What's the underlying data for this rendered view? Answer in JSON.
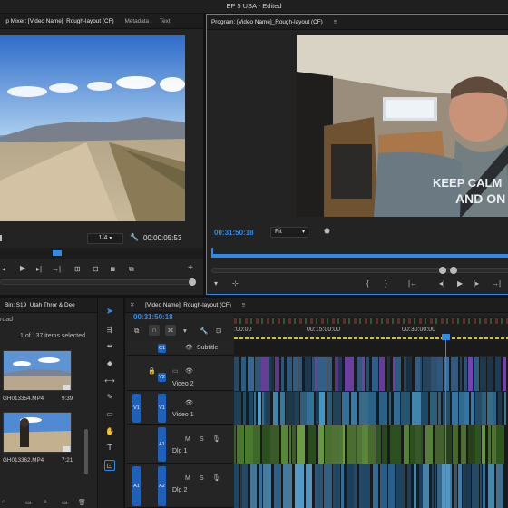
{
  "app": {
    "title": "EP 5 USA - Edited"
  },
  "source_monitor": {
    "tabs": [
      "ip Mixer: [Video Name]_Rough-layout (CF)",
      "Metadata",
      "Text"
    ],
    "resolution": "1/4",
    "timecode": "00:00:05:53"
  },
  "program_monitor": {
    "title": "Program: [Video Name]_Rough-layout (CF)",
    "timecode": "00:31:50:18",
    "zoom": "Fit",
    "shirt_text_1": "KEEP CALM",
    "shirt_text_2": "AND ON"
  },
  "bin": {
    "title": "Bin: S19_Utah Thror & Dee",
    "subtitle": "road",
    "count": "1 of 137 items selected",
    "items": [
      {
        "name": "GH013354.MP4",
        "duration": "9:39"
      },
      {
        "name": "GH013362.MP4",
        "duration": "7:21"
      }
    ]
  },
  "timeline": {
    "tab": "[Video Name]_Rough-layout (CF)",
    "timecode": "00:31:50:18",
    "ruler": [
      ":00:00",
      "00:15:00:00",
      "00:30:00:00"
    ],
    "tracks": [
      {
        "src": "",
        "id": "C1",
        "name": "Subtitle"
      },
      {
        "src": "",
        "id": "V2",
        "name": "Video 2"
      },
      {
        "src": "V1",
        "id": "V1",
        "name": "Video 1"
      },
      {
        "src": "",
        "id": "A1",
        "name": "Dlg 1"
      },
      {
        "src": "A1",
        "id": "A2",
        "name": "Dlg 2"
      }
    ],
    "track_buttons": {
      "mute": "M",
      "solo": "S"
    }
  },
  "colors": {
    "accent": "#2d8ceb",
    "audio_green": "#5e8f3a",
    "video_blue": "#3a87b8",
    "purple": "#7a46b8"
  }
}
